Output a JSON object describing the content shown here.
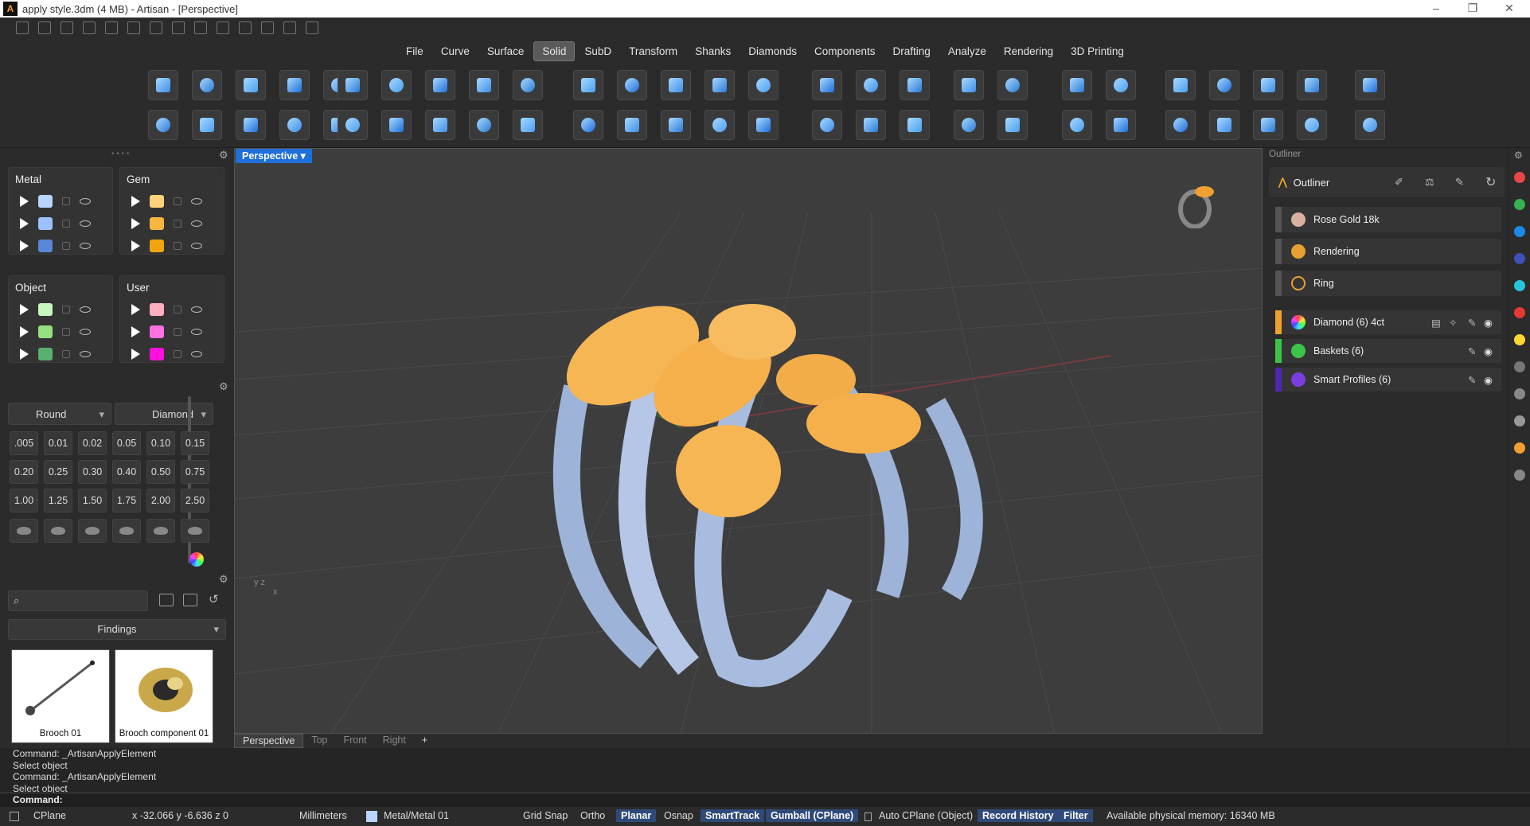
{
  "window": {
    "title": "apply style.3dm (4 MB) - Artisan - [Perspective]"
  },
  "menu": [
    "File",
    "Curve",
    "Surface",
    "Solid",
    "SubD",
    "Transform",
    "Shanks",
    "Diamonds",
    "Components",
    "Drafting",
    "Analyze",
    "Rendering",
    "3D Printing"
  ],
  "active_menu": "Solid",
  "layers": {
    "metal": {
      "label": "Metal",
      "colors": [
        "#b8d4ff",
        "#9dc0ff",
        "#5a86d8"
      ]
    },
    "gem": {
      "label": "Gem",
      "colors": [
        "#ffd27a",
        "#f7b640",
        "#f0a410"
      ]
    },
    "object": {
      "label": "Object",
      "colors": [
        "#c8f5c0",
        "#94e080",
        "#5ab070"
      ]
    },
    "user": {
      "label": "User",
      "colors": [
        "#ffb0c0",
        "#ff70e0",
        "#ff10e0"
      ]
    }
  },
  "gem_settings": {
    "shape": "Round",
    "material": "Diamond"
  },
  "sizes": [
    ".005",
    "0.01",
    "0.02",
    "0.05",
    "0.10",
    "0.15",
    "0.20",
    "0.25",
    "0.30",
    "0.40",
    "0.50",
    "0.75",
    "1.00",
    "1.25",
    "1.50",
    "1.75",
    "2.00",
    "2.50"
  ],
  "library": {
    "category": "Findings",
    "items": [
      {
        "label": "Brooch 01"
      },
      {
        "label": "Brooch component 01"
      }
    ]
  },
  "viewport": {
    "active": "Perspective",
    "tabs": [
      "Perspective",
      "Top",
      "Front",
      "Right"
    ]
  },
  "outliner": {
    "panel_label": "Outliner",
    "title": "Outliner",
    "items": [
      {
        "label": "Rose Gold 18k"
      },
      {
        "label": "Rendering"
      },
      {
        "label": "Ring"
      }
    ],
    "objects": [
      {
        "label": "Diamond (6) 4ct",
        "color": "#f0a030"
      },
      {
        "label": "Baskets (6)",
        "color": "#3cc44a"
      },
      {
        "label": "Smart Profiles (6)",
        "color": "#4b2ab0"
      }
    ]
  },
  "command_log": [
    "Command: _ArtisanApplyElement",
    "Select object",
    "Command: _ArtisanApplyElement",
    "Select object"
  ],
  "command_prompt": "Command:",
  "status": {
    "cplane": "CPlane",
    "coords": "x -32.066  y -6.636  z 0",
    "units": "Millimeters",
    "layer": "Metal/Metal 01",
    "grid_snap": "Grid Snap",
    "ortho": "Ortho",
    "planar": "Planar",
    "osnap": "Osnap",
    "smarttrack": "SmartTrack",
    "gumball": "Gumball (CPlane)",
    "auto_cplane": "Auto CPlane (Object)",
    "record_history": "Record History",
    "filter": "Filter",
    "memory": "Available physical memory: 16340 MB"
  }
}
